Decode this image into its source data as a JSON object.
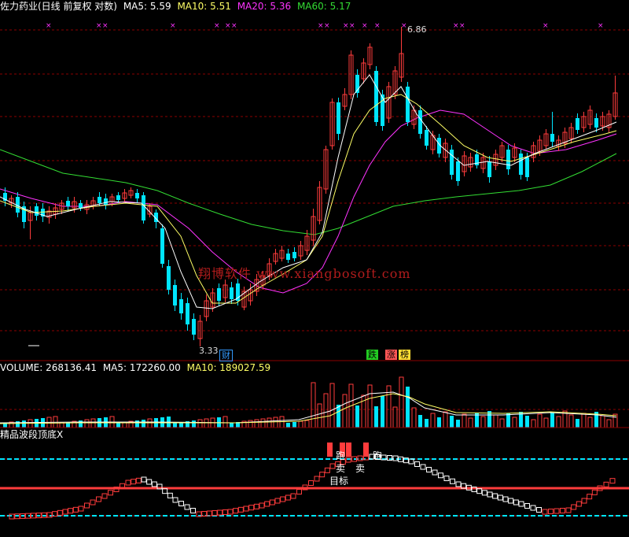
{
  "colors": {
    "bg": "#000000",
    "grid": "#8b0000",
    "up": "#ff3c3c",
    "down": "#00e5ff",
    "ma5": "#ffffff",
    "ma10": "#ffff66",
    "ma20": "#ff33ff",
    "ma60": "#33dd33",
    "watermark": "#b01c1c",
    "magenta": "#ff33ff",
    "text": "#ffffff"
  },
  "price_panel": {
    "title": "佐力药业(日线 前复权 对数)",
    "ma5_label": "MA5: 5.59",
    "ma10_label": "MA10: 5.51",
    "ma20_label": "MA20: 5.36",
    "ma60_label": "MA60: 5.17",
    "high_label": "6.86",
    "low_label": "3.33",
    "cai_badge": "财",
    "die_badge": "跌",
    "zhang_badge": "涨",
    "bang_badge": "榜",
    "watermark": "翔博软件 www.xiangbosoft.com"
  },
  "volume_panel": {
    "volume_label": "VOLUME: 268136.41",
    "ma5_label": "MA5: 172260.00",
    "ma10_label": "MA10: 189027.59"
  },
  "indicator_panel": {
    "title": "精品波段顶底X",
    "paopao_label": "跑",
    "mai_label": "卖",
    "paopao2_label": "跑",
    "mai2_label": "卖",
    "target_label": "目标"
  }
}
